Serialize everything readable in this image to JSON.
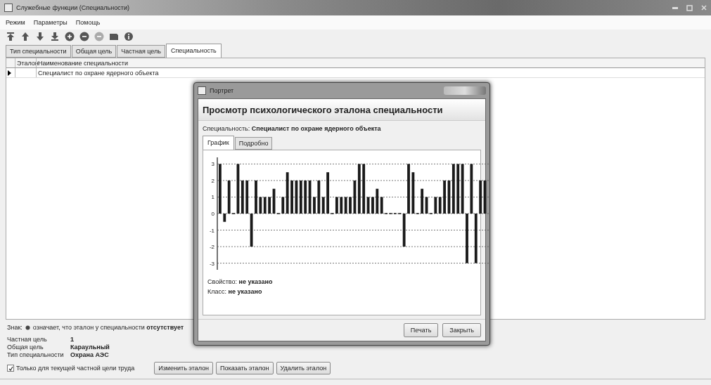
{
  "window": {
    "title": "Служебные функции (Специальности)"
  },
  "menu": [
    "Режим",
    "Параметры",
    "Помощь"
  ],
  "toolbar": [
    {
      "kind": "first",
      "disabled": false
    },
    {
      "kind": "up",
      "disabled": false
    },
    {
      "kind": "down",
      "disabled": false
    },
    {
      "kind": "last",
      "disabled": false
    },
    {
      "kind": "add",
      "disabled": false
    },
    {
      "kind": "remove",
      "disabled": false
    },
    {
      "kind": "remove",
      "disabled": true
    },
    {
      "kind": "save",
      "disabled": false
    },
    {
      "kind": "info",
      "disabled": false
    }
  ],
  "tabs": [
    {
      "label": "Тип специальности",
      "selected": false
    },
    {
      "label": "Общая цель",
      "selected": false
    },
    {
      "label": "Частная цель",
      "selected": false
    },
    {
      "label": "Специальность",
      "selected": true
    }
  ],
  "table": {
    "columns": [
      "Эталон",
      "Наименование специальности"
    ],
    "rows": [
      {
        "selected": true,
        "cells": [
          "",
          "Специалист по охране ядерного объекта"
        ]
      }
    ]
  },
  "legend": {
    "prefix": "Знак:",
    "text": "означает, что эталон у специальности **отсутствует**"
  },
  "info": [
    {
      "label": "Частная цель",
      "value": "1"
    },
    {
      "label": "Общая цель",
      "value": "Караульный"
    },
    {
      "label": "Тип специальности",
      "value": "Охрана АЭС"
    }
  ],
  "filter": {
    "label": "Только для текущей частной цели труда",
    "checked": true
  },
  "buttons": [
    "Изменить эталон",
    "Показать эталон",
    "Удалить эталон"
  ],
  "dialog": {
    "title": "Портрет",
    "heading": "Просмотр психологического эталона специальности",
    "specialty": "Специальность: **Специалист по охране ядерного объекта**",
    "tabs": [
      {
        "label": "График",
        "selected": true
      },
      {
        "label": "Подробно",
        "selected": false
      }
    ],
    "chart_data": {
      "type": "bar",
      "grid": true,
      "ylim": [
        -3.4,
        3.4
      ],
      "yticks": [
        -3,
        -2,
        -1,
        0,
        1,
        2,
        3
      ],
      "values": [
        3,
        -0.5,
        2,
        0,
        3,
        2,
        2,
        -2,
        2,
        1,
        1,
        1,
        1.5,
        0,
        1,
        2.5,
        2,
        2,
        2,
        2,
        2,
        1,
        2,
        1,
        2.5,
        0,
        1,
        1,
        1,
        1,
        2,
        3,
        3,
        1,
        1,
        1.5,
        1,
        0,
        0,
        0,
        0,
        -2,
        3,
        2.5,
        0,
        1.5,
        1,
        0,
        1,
        1,
        2,
        2,
        3,
        3,
        3,
        -3,
        3,
        -3,
        2,
        2
      ]
    },
    "fields": [
      "Свойство: **не указано**",
      "Класс: **не указано**"
    ],
    "buttons": [
      "Печать",
      "Закрыть"
    ]
  }
}
